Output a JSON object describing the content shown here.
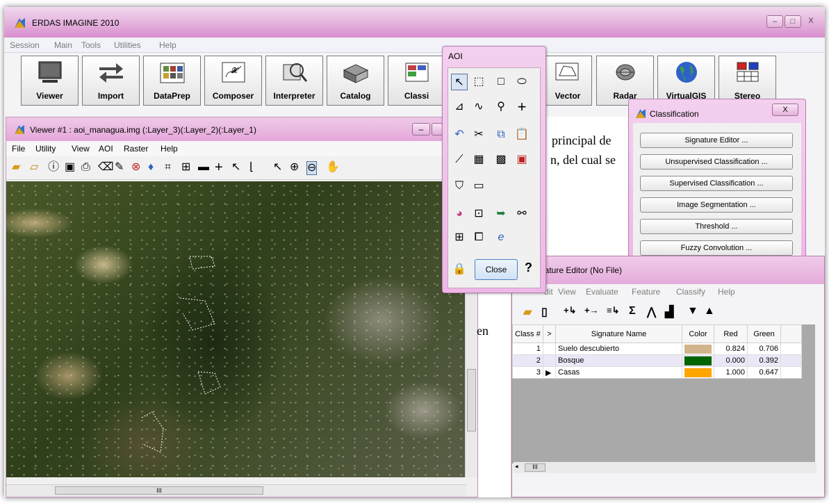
{
  "app": {
    "title": "ERDAS IMAGINE 2010",
    "menu": [
      "Session",
      "Main",
      "Tools",
      "Utilities",
      "Help"
    ],
    "toolbar": [
      "Viewer",
      "Import",
      "DataPrep",
      "Composer",
      "Interpreter",
      "Catalog",
      "Classi",
      "Vector",
      "Radar",
      "VirtualGIS",
      "Stereo"
    ]
  },
  "viewer": {
    "title": "Viewer #1 : aoi_managua.img (:Layer_3)(:Layer_2)(:Layer_1)",
    "menu": [
      "File",
      "Utility",
      "View",
      "AOI",
      "Raster",
      "Help"
    ],
    "scroll_label": "III"
  },
  "document": {
    "line1": "principal de",
    "line2": "n, del cual se",
    "line3": "en"
  },
  "aoi": {
    "title": "AOI",
    "close_label": "Close",
    "help_label": "?"
  },
  "classification": {
    "title": "Classification",
    "close_label": "X",
    "buttons": [
      "Signature Editor ...",
      "Unsupervised Classification ...",
      "Supervised Classification ...",
      "Image Segmentation ...",
      "Threshold ...",
      "Fuzzy Convolution ..."
    ]
  },
  "signature_editor": {
    "title": "nature Editor (No File)",
    "menu": [
      "dit",
      "View",
      "Evaluate",
      "Feature",
      "Classify",
      "Help"
    ],
    "columns": [
      "Class #",
      ">",
      "Signature Name",
      "Color",
      "Red",
      "Green"
    ],
    "rows": [
      {
        "cls": "1",
        "mark": "",
        "name": "Suelo descubierto",
        "color": "#d2b48c",
        "red": "0.824",
        "green": "0.706"
      },
      {
        "cls": "2",
        "mark": "",
        "name": "Bosque",
        "color": "#006400",
        "red": "0.000",
        "green": "0.392"
      },
      {
        "cls": "3",
        "mark": "▶",
        "name": "Casas",
        "color": "#ffa500",
        "red": "1.000",
        "green": "0.647"
      }
    ],
    "scroll_label": "III"
  }
}
